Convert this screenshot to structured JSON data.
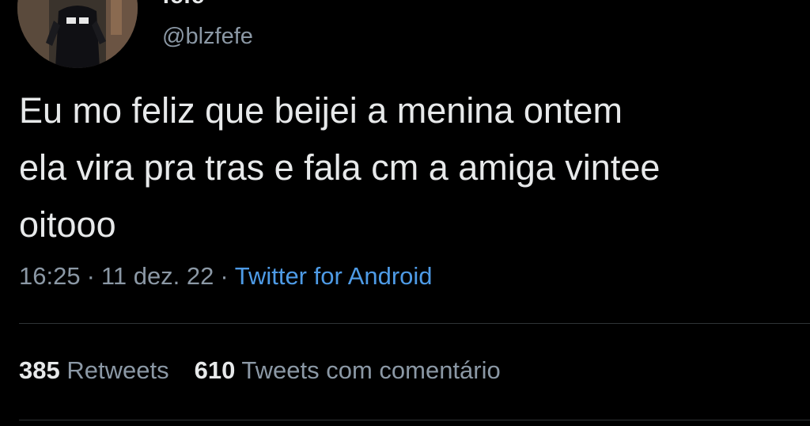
{
  "user": {
    "display_name": "fefe",
    "handle": "@blzfefe",
    "avatar": "profile-photo"
  },
  "tweet": {
    "lines": [
      "Eu mo feliz que beijei a menina ontem",
      "ela vira pra tras e fala cm a amiga vintee",
      "oitooo"
    ],
    "time": "16:25",
    "separator": "·",
    "date": "11 dez. 22",
    "source": "Twitter for Android"
  },
  "stats": {
    "retweets_count": "385",
    "retweets_label": "Retweets",
    "quotes_count": "610",
    "quotes_label": "Tweets com comentário"
  },
  "colors": {
    "background": "#000000",
    "text": "#e7e9ea",
    "secondary": "#8b98a5",
    "link": "#4e9be6",
    "divider": "#2f3336"
  }
}
